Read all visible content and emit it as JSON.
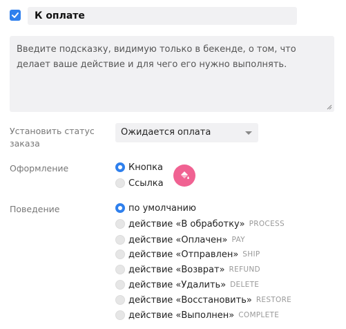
{
  "enabled_checkbox": {
    "checked": true
  },
  "title_value": "К оплате",
  "hint_text": "Введите подсказку, видимую только в бекенде, о том, что делает ваше действие и для чего его нужно выполнять.",
  "status": {
    "label": "Установить статус заказа",
    "selected": "Ожидается оплата"
  },
  "appearance": {
    "label": "Оформление",
    "options": [
      {
        "label": "Кнопка",
        "selected": true
      },
      {
        "label": "Ссылка",
        "selected": false
      }
    ],
    "color_picker_icon": "paint-bucket-icon",
    "accent_color": "#f06292"
  },
  "behavior": {
    "label": "Поведение",
    "options": [
      {
        "label": "по умолчанию",
        "code": "",
        "selected": true
      },
      {
        "label": "действие «В обработку»",
        "code": "PROCESS",
        "selected": false
      },
      {
        "label": "действие «Оплачен»",
        "code": "PAY",
        "selected": false
      },
      {
        "label": "действие «Отправлен»",
        "code": "SHIP",
        "selected": false
      },
      {
        "label": "действие «Возврат»",
        "code": "REFUND",
        "selected": false
      },
      {
        "label": "действие «Удалить»",
        "code": "DELETE",
        "selected": false
      },
      {
        "label": "действие «Восстановить»",
        "code": "RESTORE",
        "selected": false
      },
      {
        "label": "действие «Выполнен»",
        "code": "COMPLETE",
        "selected": false
      }
    ]
  },
  "colors": {
    "primary": "#2f80ed",
    "field_bg": "#f1f1f3"
  }
}
